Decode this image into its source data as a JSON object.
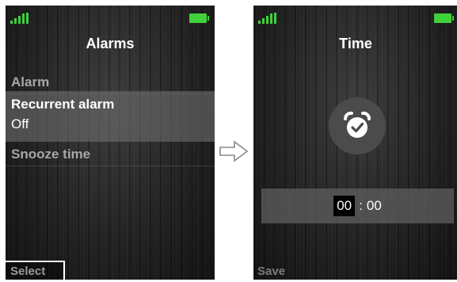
{
  "left_screen": {
    "title": "Alarms",
    "menu": {
      "alarm_label": "Alarm",
      "recurrent_label": "Recurrent alarm",
      "recurrent_value": "Off",
      "snooze_label": "Snooze time"
    },
    "softkey_left": "Select"
  },
  "right_screen": {
    "title": "Time",
    "time": {
      "hours": "00",
      "separator": ":",
      "minutes": "00"
    },
    "softkey_left": "Save"
  },
  "icons": {
    "signal": "signal-strength-icon",
    "battery": "battery-icon",
    "arrow": "right-arrow-icon",
    "alarm_clock": "alarm-clock-check-icon"
  },
  "colors": {
    "status_green": "#3fd13a",
    "highlight": "#6e6e6e",
    "text_dim": "#a7a7a7"
  }
}
